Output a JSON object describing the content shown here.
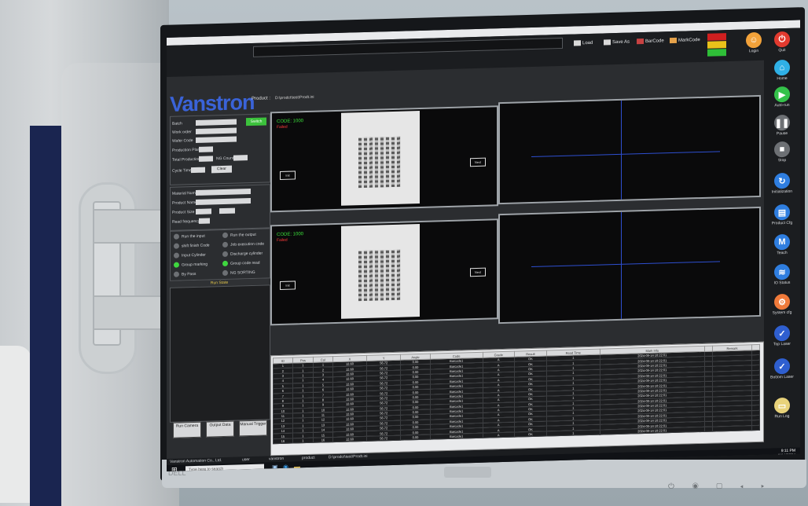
{
  "toolbar": {
    "load": "Load",
    "save_as": "Save As",
    "bar_code": "BarCode",
    "mark_code": "MarkCode",
    "path_value": "",
    "lights": [
      "#d01f1f",
      "#e9c21a",
      "#2fbf38"
    ]
  },
  "brand": {
    "logo": "Vanstron",
    "product_label": "Product :",
    "product_path": "D:\\prodct\\test\\Prodt.ini"
  },
  "sidebar": [
    {
      "label": "Login",
      "icon": "user-icon",
      "color": "#f2a23a"
    },
    {
      "label": "Quit",
      "icon": "power-icon",
      "color": "#e23a2f"
    },
    {
      "label": "Home",
      "icon": "home-icon",
      "color": "#2fb0e6"
    },
    {
      "label": "Auto-run",
      "icon": "play-icon",
      "color": "#34c24a"
    },
    {
      "label": "Pause",
      "icon": "pause-icon",
      "color": "#6d7074"
    },
    {
      "label": "Stop",
      "icon": "stop-icon",
      "color": "#6d7074"
    },
    {
      "label": "Initialization",
      "icon": "refresh-icon",
      "color": "#2f7ee0"
    },
    {
      "label": "Product Cfg",
      "icon": "product-config-icon",
      "color": "#2f7ee0"
    },
    {
      "label": "Teach",
      "icon": "teach-icon",
      "color": "#2f7ee0"
    },
    {
      "label": "IO Status",
      "icon": "io-status-icon",
      "color": "#2f7ee0"
    },
    {
      "label": "System cfg",
      "icon": "system-config-icon",
      "color": "#f07a3a"
    },
    {
      "label": "Top Laser",
      "icon": "top-laser-icon",
      "color": "#2f5fd0"
    },
    {
      "label": "Bottom Laser",
      "icon": "bottom-laser-icon",
      "color": "#2f5fd0"
    },
    {
      "label": "Run Log",
      "icon": "run-log-icon",
      "color": "#e8d27a"
    }
  ],
  "form": {
    "fields": [
      "Batch",
      "Work order",
      "Wafer Code",
      "Production Plan",
      "Total Production",
      "Cycle Time"
    ],
    "ng_count": "NG Count",
    "button": "Switch",
    "clear": "Clear"
  },
  "form2": {
    "fields": [
      "Material Number",
      "Product Name",
      "Product Size",
      "Read frequency"
    ]
  },
  "io": [
    {
      "label": "Run the input",
      "on": false
    },
    {
      "label": "Run the output",
      "on": false
    },
    {
      "label": "shift finish Code",
      "on": false
    },
    {
      "label": "Job execution code",
      "on": false
    },
    {
      "label": "Input Cylinder",
      "on": false
    },
    {
      "label": "Discharge cylinder",
      "on": false
    },
    {
      "label": "Group marking",
      "on": true
    },
    {
      "label": "Group code read",
      "on": true
    },
    {
      "label": "By Pass",
      "on": false
    },
    {
      "label": "NG SORTING",
      "on": false
    }
  ],
  "run_state_title": "Run State",
  "bottom_buttons": [
    "Run Camera",
    "Output Data",
    "Manual Trigger"
  ],
  "cameras": [
    {
      "head": "",
      "code": "CODE: 1000",
      "fail": "Failed",
      "box_left": "Init",
      "box_right": "Next"
    },
    {
      "head": "",
      "code": "CODE: 1000",
      "fail": "Failed",
      "box_left": "Init",
      "box_right": "Next"
    }
  ],
  "table": {
    "headers": [
      "ID",
      "Pos",
      "Col",
      "X",
      "Y",
      "Angle",
      "Code",
      "Grade",
      "Result",
      "Read Time",
      "Mark Info",
      "",
      "Remark",
      ""
    ],
    "rows": [
      [
        "1",
        "1",
        "1",
        "12.60",
        "56.72",
        "0.00",
        "Barcode1",
        "A",
        "OK",
        "1",
        "2024-09-14 10:22:01",
        "",
        "",
        ""
      ],
      [
        "2",
        "1",
        "2",
        "12.60",
        "56.72",
        "0.00",
        "Barcode1",
        "A",
        "OK",
        "1",
        "2024-09-14 10:22:01",
        "",
        "",
        ""
      ],
      [
        "3",
        "1",
        "3",
        "12.60",
        "56.72",
        "0.00",
        "Barcode1",
        "A",
        "OK",
        "1",
        "2024-09-14 10:22:01",
        "",
        "",
        ""
      ],
      [
        "4",
        "1",
        "4",
        "12.60",
        "56.72",
        "0.00",
        "Barcode1",
        "A",
        "OK",
        "1",
        "2024-09-14 10:22:01",
        "",
        "",
        ""
      ],
      [
        "5",
        "1",
        "5",
        "12.60",
        "56.72",
        "0.00",
        "Barcode1",
        "A",
        "OK",
        "1",
        "2024-09-14 10:22:01",
        "",
        "",
        ""
      ],
      [
        "6",
        "1",
        "6",
        "12.60",
        "56.72",
        "0.00",
        "Barcode1",
        "A",
        "OK",
        "1",
        "2024-09-14 10:22:01",
        "",
        "",
        ""
      ],
      [
        "7",
        "1",
        "7",
        "12.60",
        "56.72",
        "0.00",
        "Barcode1",
        "A",
        "OK",
        "1",
        "2024-09-14 10:22:01",
        "",
        "",
        ""
      ],
      [
        "8",
        "1",
        "8",
        "12.60",
        "56.72",
        "0.00",
        "Barcode1",
        "A",
        "OK",
        "1",
        "2024-09-14 10:22:01",
        "",
        "",
        ""
      ],
      [
        "9",
        "1",
        "9",
        "12.60",
        "56.72",
        "0.00",
        "Barcode1",
        "A",
        "OK",
        "1",
        "2024-09-14 10:22:01",
        "",
        "",
        ""
      ],
      [
        "10",
        "1",
        "10",
        "12.60",
        "56.72",
        "0.00",
        "Barcode1",
        "A",
        "OK",
        "1",
        "2024-09-14 10:22:01",
        "",
        "",
        ""
      ],
      [
        "11",
        "1",
        "11",
        "12.60",
        "56.72",
        "0.00",
        "Barcode1",
        "A",
        "OK",
        "1",
        "2024-09-14 10:22:01",
        "",
        "",
        ""
      ],
      [
        "12",
        "1",
        "12",
        "12.60",
        "56.72",
        "0.00",
        "Barcode1",
        "A",
        "OK",
        "1",
        "2024-09-14 10:22:01",
        "",
        "",
        ""
      ],
      [
        "13",
        "1",
        "13",
        "12.60",
        "56.72",
        "0.00",
        "Barcode1",
        "A",
        "OK",
        "1",
        "2024-09-14 10:22:01",
        "",
        "",
        ""
      ],
      [
        "14",
        "1",
        "14",
        "12.60",
        "56.72",
        "0.00",
        "Barcode1",
        "A",
        "OK",
        "1",
        "2024-09-14 10:22:01",
        "",
        "",
        ""
      ],
      [
        "15",
        "1",
        "15",
        "12.60",
        "56.72",
        "0.00",
        "Barcode1",
        "A",
        "OK",
        "1",
        "2024-09-14 10:22:01",
        "",
        "",
        ""
      ],
      [
        "16",
        "1",
        "16",
        "12.60",
        "56.72",
        "0.00",
        "Barcode1",
        "A",
        "OK",
        "1",
        "2024-09-14 10:22:01",
        "",
        "",
        ""
      ]
    ]
  },
  "status_bar": {
    "company": "Vanstron Automation Co., Ltd.",
    "user": "user",
    "user_name": "vanstron",
    "product": "product",
    "product_path": "D:\\prodct\\test\\Prodt.ini"
  },
  "taskbar": {
    "search_placeholder": "Type here to search",
    "time": "9:11 PM",
    "date": "9/14/2024"
  },
  "monitor": {
    "brand": "DELL"
  }
}
